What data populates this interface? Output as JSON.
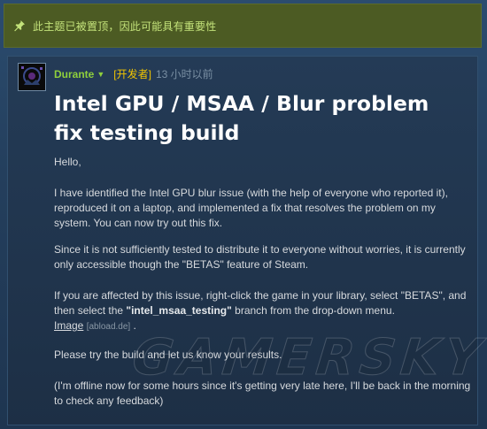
{
  "sticky": {
    "icon": "pin-icon",
    "text": "此主题已被置顶，因此可能具有重要性"
  },
  "post": {
    "author": "Durante",
    "author_menu_icon": "caret-down-icon",
    "badge": "[开发者]",
    "time": "13 小时以前",
    "title": "Intel GPU / MSAA / Blur problem fix testing build",
    "greeting": "Hello,",
    "p1": "I have identified the Intel GPU blur issue (with the help of everyone who reported it), reproduced it on a laptop, and implemented a fix that resolves the problem on my system. You can now try out this fix.",
    "p2": "Since it is not sufficiently tested to distribute it to everyone without worries, it is currently only accessible though the \"BETAS\" feature of Steam.",
    "p3_before": "If you are affected by this issue, right-click the game in your library, select \"BETAS\", and then select the ",
    "p3_branch": "\"intel_msaa_testing\"",
    "p3_after": " branch from the drop-down menu.",
    "image_link": "Image",
    "image_source": "[abload.de]",
    "image_period": ".",
    "p4": "Please try the build and let us know your results.",
    "p5": "(I'm offline now for some hours since it's getting very late here, I'll be back in the morning to check any feedback)"
  },
  "colors": {
    "sticky_bg": "#4c5b23",
    "sticky_text": "#c3e27a",
    "author": "#8fcf3c",
    "dev_badge": "#f2c500"
  }
}
